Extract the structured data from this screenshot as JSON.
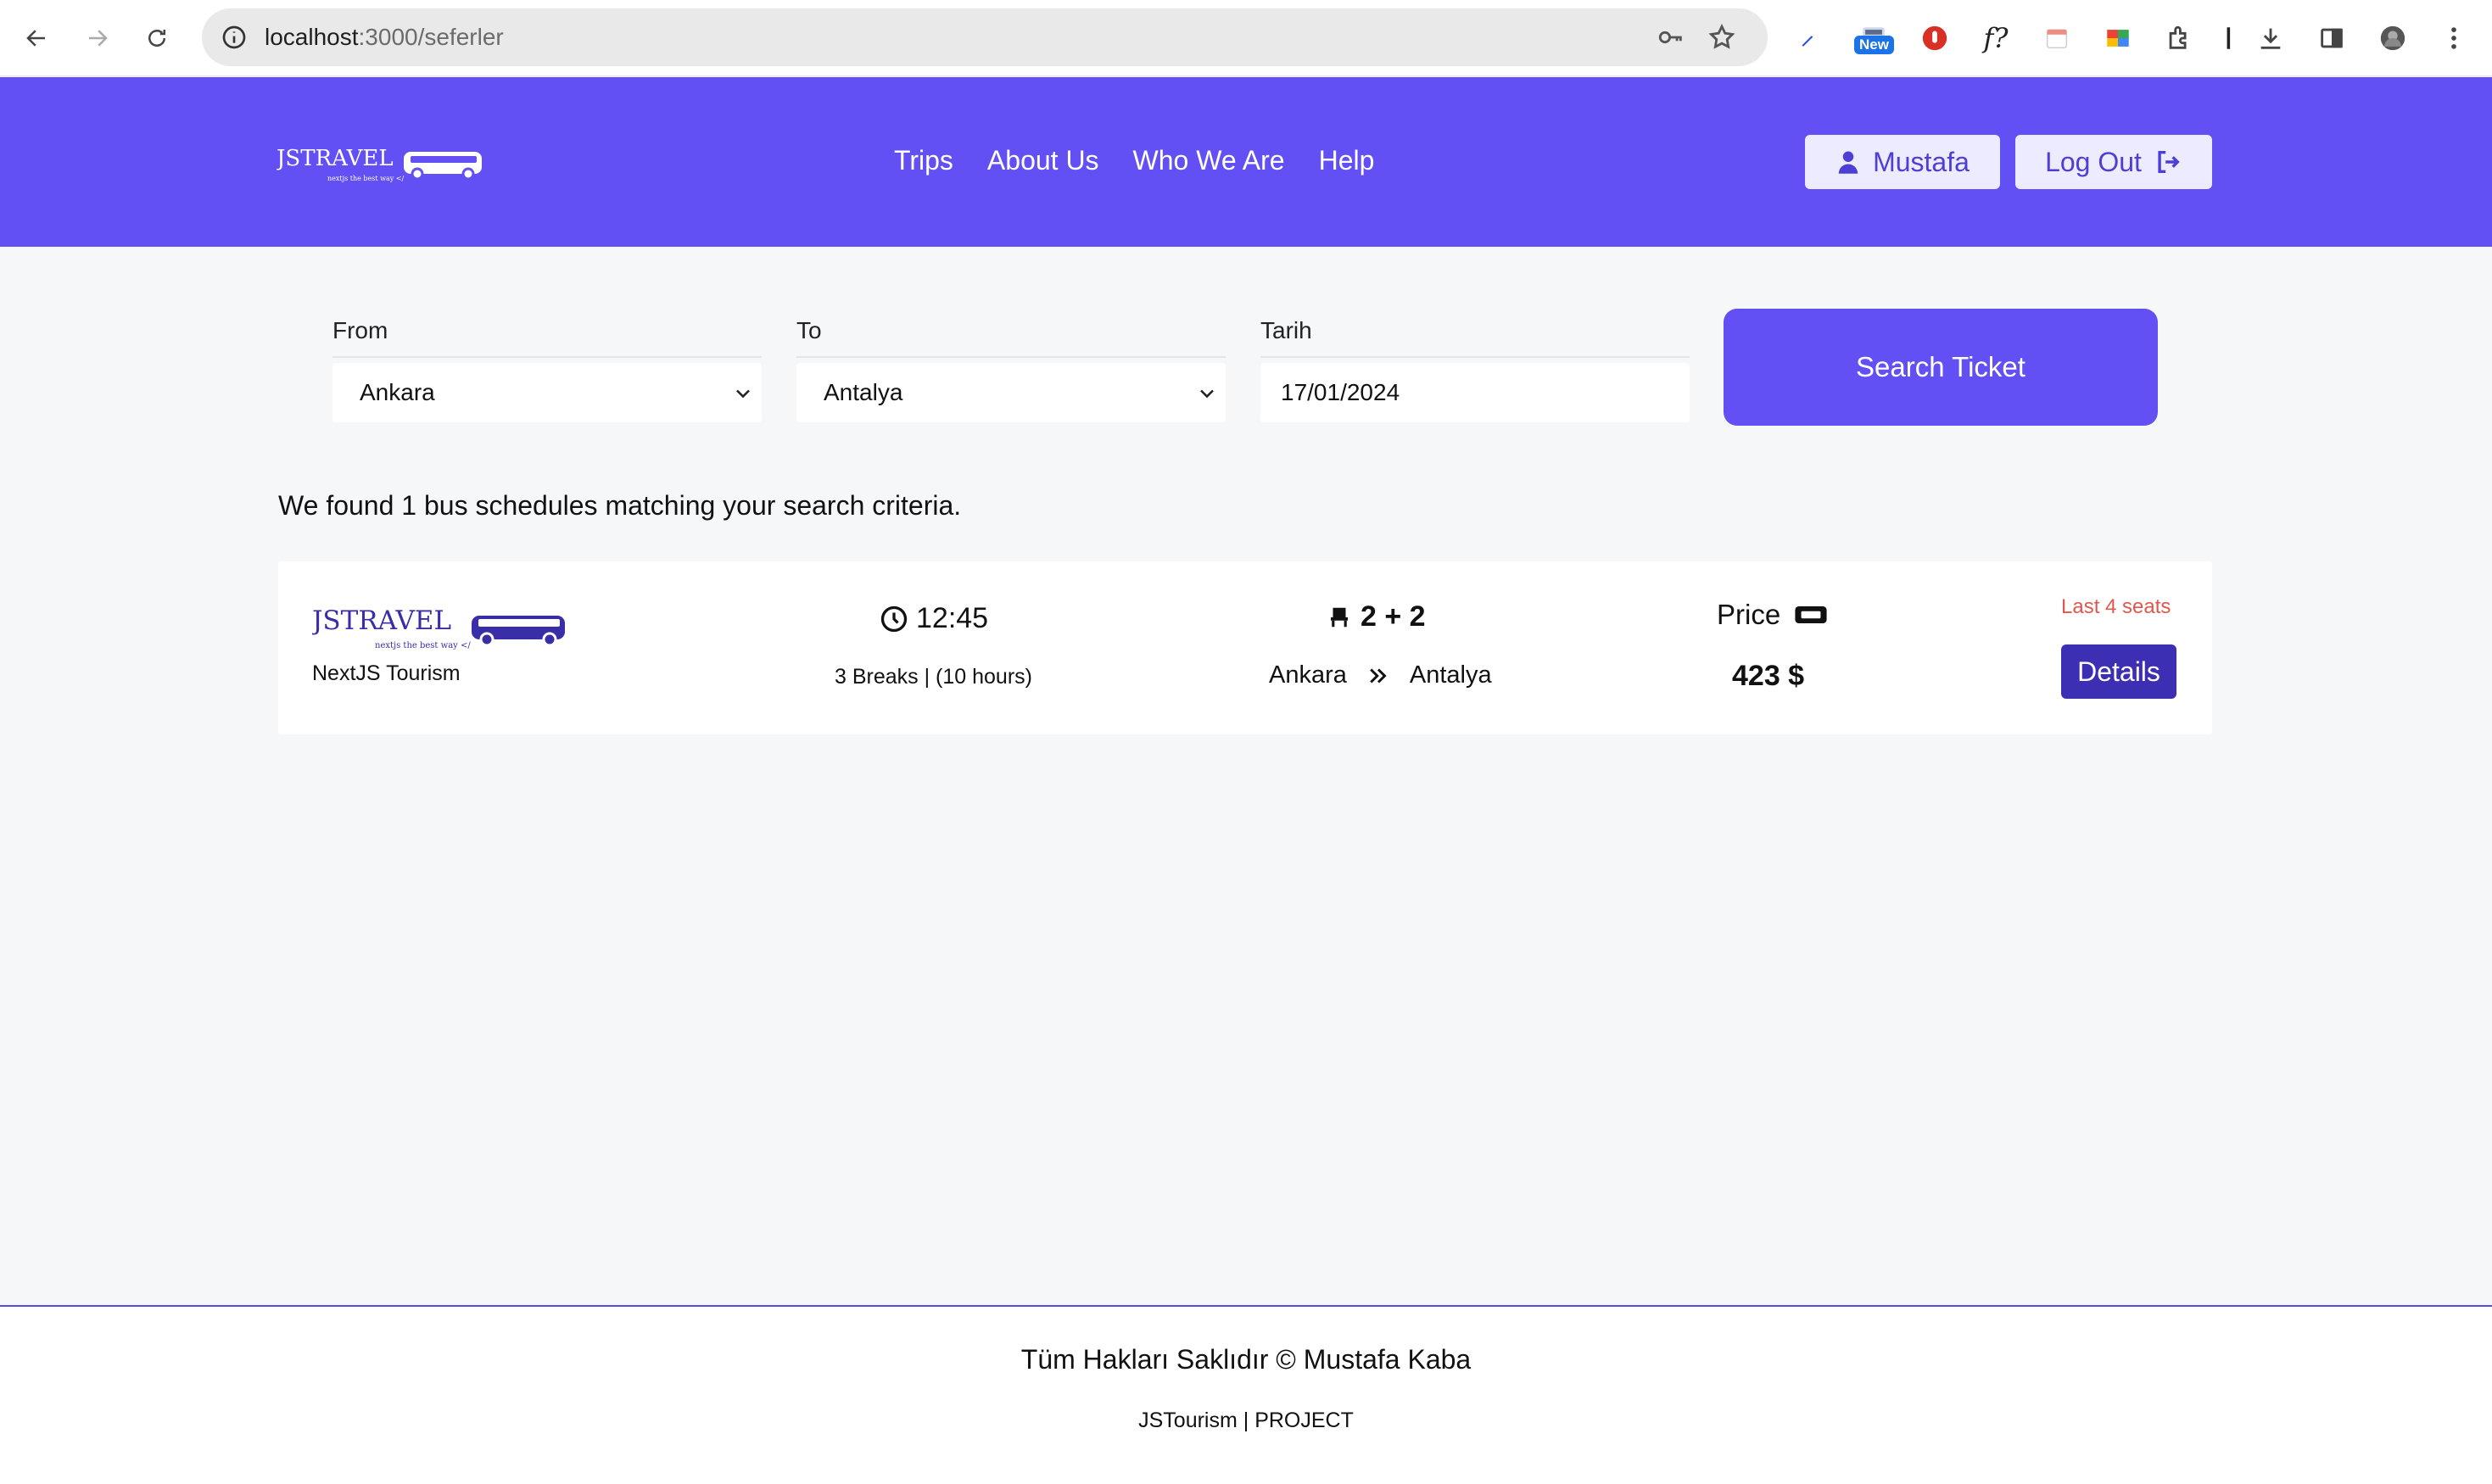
{
  "browser": {
    "url_host": "localhost",
    "url_path": ":3000/seferler",
    "extension_badge": "New",
    "extension_f_label": "f?"
  },
  "header": {
    "logo_text": "JSTRAVEL",
    "logo_tagline": "nextjs the best way </",
    "nav": [
      "Trips",
      "About Us",
      "Who We Are",
      "Help"
    ],
    "user_label": "Mustafa",
    "logout_label": "Log Out",
    "brand_color": "#6250f5"
  },
  "search": {
    "from_label": "From",
    "from_value": "Ankara",
    "to_label": "To",
    "to_value": "Antalya",
    "date_label": "Tarih",
    "date_value": "17/01/2024",
    "button_label": "Search Ticket"
  },
  "results": {
    "summary": "We found 1 bus schedules matching your search criteria.",
    "items": [
      {
        "logo_text": "JSTRAVEL",
        "logo_tagline": "nextjs the best way </",
        "company": "NextJS Tourism",
        "departure": "12:45",
        "breaks": "3 Breaks | (10 hours)",
        "seat_layout": "2 + 2",
        "origin": "Ankara",
        "destination": "Antalya",
        "price_label": "Price",
        "price": "423 $",
        "availability": "Last 4 seats",
        "details_label": "Details",
        "availability_color": "#e2574c"
      }
    ]
  },
  "footer": {
    "copyright": "Tüm Hakları Saklıdır © Mustafa Kaba",
    "project": "JSTourism | PROJECT"
  }
}
